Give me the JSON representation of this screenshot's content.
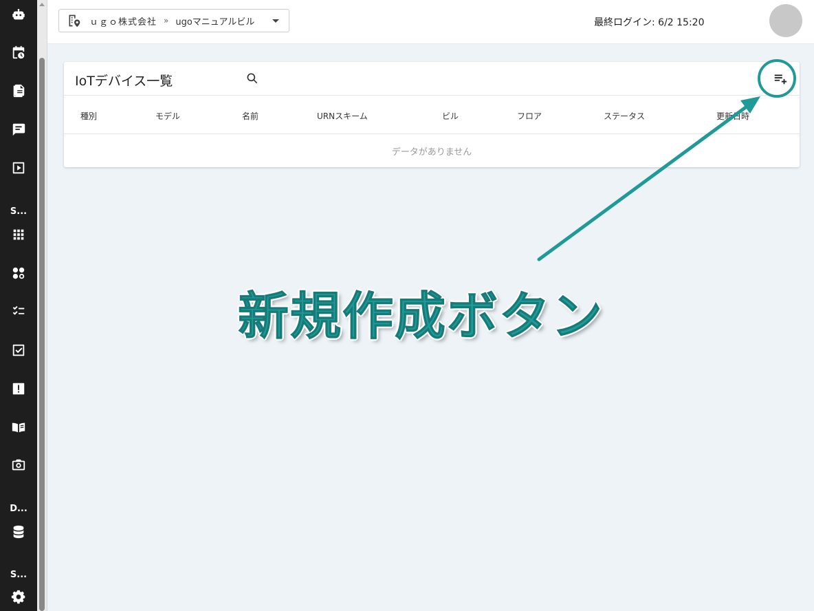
{
  "sidebar": {
    "items": [
      {
        "name": "robot-icon"
      },
      {
        "name": "calendar-clock-icon"
      },
      {
        "name": "document-icon"
      },
      {
        "name": "chat-icon"
      },
      {
        "name": "play-box-icon"
      },
      {
        "name": "grid-icon"
      },
      {
        "name": "shapes-icon"
      },
      {
        "name": "checklist-icon"
      },
      {
        "name": "task-check-icon"
      },
      {
        "name": "alert-icon"
      },
      {
        "name": "manual-book-icon"
      },
      {
        "name": "camera-icon"
      },
      {
        "name": "database-icon"
      },
      {
        "name": "gear-icon"
      }
    ],
    "sections": [
      "S...",
      "D...",
      "S..."
    ]
  },
  "header": {
    "org": "ｕｇｏ株式会社",
    "separator": "»",
    "building": "ugoマニュアルビル",
    "last_login": "最終ログイン: 6/2 15:20"
  },
  "card": {
    "title": "IoTデバイス一覧",
    "columns": [
      "種別",
      "モデル",
      "名前",
      "URNスキーム",
      "ビル",
      "フロア",
      "ステータス",
      "更新日時"
    ],
    "empty_text": "データがありません"
  },
  "annotation": {
    "label": "新規作成ボタン",
    "color": "#1f9a97"
  }
}
